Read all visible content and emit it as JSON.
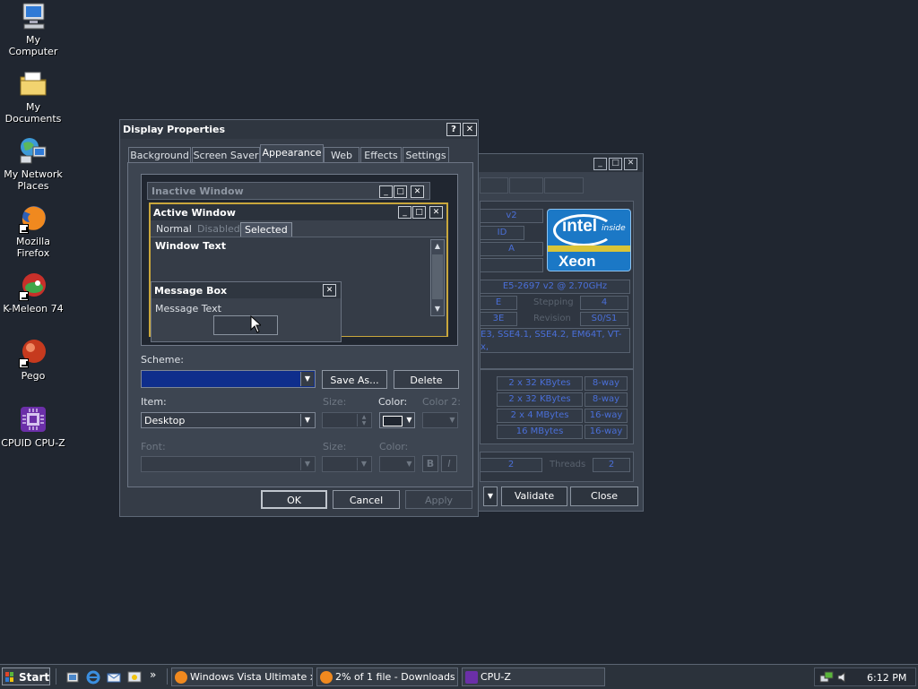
{
  "desktop": {
    "icons": [
      {
        "label": "My Computer",
        "icon": "computer-icon"
      },
      {
        "label": "My Documents",
        "icon": "folder-documents-icon"
      },
      {
        "label": "My Network Places",
        "icon": "network-icon"
      },
      {
        "label": "Mozilla Firefox",
        "icon": "firefox-icon"
      },
      {
        "label": "K-Meleon 74",
        "icon": "k-meleon-icon"
      },
      {
        "label": "Pego",
        "icon": "pego-icon"
      },
      {
        "label": "CPUID CPU-Z",
        "icon": "cpuz-icon"
      }
    ]
  },
  "display_properties": {
    "title": "Display Properties",
    "help_label": "?",
    "close_label": "✕",
    "tabs": [
      "Background",
      "Screen Saver",
      "Appearance",
      "Web",
      "Effects",
      "Settings"
    ],
    "active_tab": "Appearance",
    "preview": {
      "inactive_title": "Inactive Window",
      "active_title": "Active Window",
      "menu": [
        "Normal",
        "Disabled",
        "Selected"
      ],
      "window_text": "Window Text",
      "message_box_title": "Message Box",
      "message_text": "Message Text"
    },
    "scheme_label": "Scheme:",
    "scheme_value": "",
    "save_as_label": "Save As...",
    "delete_label": "Delete",
    "item_label": "Item:",
    "item_value": "Desktop",
    "size_label": "Size:",
    "color_label": "Color:",
    "color2_label": "Color 2:",
    "font_label": "Font:",
    "font_size_label": "Size:",
    "font_color_label": "Color:",
    "bold_label": "B",
    "italic_label": "I",
    "ok_label": "OK",
    "cancel_label": "Cancel",
    "apply_label": "Apply"
  },
  "cpuz": {
    "fields": {
      "spec_suffix": "v2",
      "id_fragment": "ID",
      "na_fragment": "A",
      "spec": "E5-2697 v2 @ 2.70GHz",
      "family": "E",
      "stepping": "4",
      "model": "3E",
      "revision": "S0/S1",
      "instructions": "E3, SSE4.1, SSE4.2, EM64T, VT-x,",
      "cores": "2",
      "threads": "2"
    },
    "ghost_labels": {
      "stepping": "Stepping",
      "revision": "Revision",
      "threads": "Threads"
    },
    "cache": [
      {
        "size": "2 x 32 KBytes",
        "ways": "8-way"
      },
      {
        "size": "2 x 32 KBytes",
        "ways": "8-way"
      },
      {
        "size": "2 x 4 MBytes",
        "ways": "16-way"
      },
      {
        "size": "16 MBytes",
        "ways": "16-way"
      }
    ],
    "logo_brand": "intel",
    "logo_inside": "inside",
    "logo_product": "Xeon",
    "validate_label": "Validate",
    "close_label": "Close"
  },
  "taskbar": {
    "start_label": "Start",
    "more_label": "»",
    "tasks": [
      {
        "label": "Windows Vista Ultimate x...",
        "icon": "firefox-icon"
      },
      {
        "label": "2% of 1 file - Downloads",
        "icon": "firefox-icon"
      },
      {
        "label": "CPU-Z",
        "icon": "cpuz-icon"
      }
    ],
    "clock": "6:12 PM"
  }
}
